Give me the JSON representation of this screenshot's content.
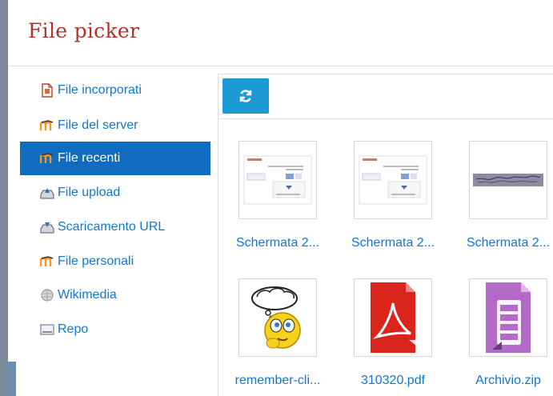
{
  "dialog": {
    "title": "File picker"
  },
  "sidebar": {
    "items": [
      {
        "label": "File incorporati",
        "icon": "embedded-file-icon",
        "active": false
      },
      {
        "label": "File del server",
        "icon": "moodle-icon",
        "active": false
      },
      {
        "label": "File recenti",
        "icon": "moodle-icon",
        "active": true
      },
      {
        "label": "File upload",
        "icon": "upload-icon",
        "active": false
      },
      {
        "label": "Scaricamento URL",
        "icon": "url-download-icon",
        "active": false
      },
      {
        "label": "File personali",
        "icon": "moodle-icon",
        "active": false
      },
      {
        "label": "Wikimedia",
        "icon": "wikimedia-icon",
        "active": false
      },
      {
        "label": "Repo",
        "icon": "repository-icon",
        "active": false
      }
    ]
  },
  "toolbar": {
    "refresh_icon": "refresh-icon"
  },
  "files": [
    {
      "name": "Schermata 2...",
      "thumb": "screenshot-thumbnail"
    },
    {
      "name": "Schermata 2...",
      "thumb": "screenshot-thumbnail"
    },
    {
      "name": "Schermata 2...",
      "thumb": "handwriting-thumbnail"
    },
    {
      "name": "remember-cli...",
      "thumb": "thinking-smiley-icon"
    },
    {
      "name": "310320.pdf",
      "thumb": "pdf-file-icon"
    },
    {
      "name": "Archivio.zip",
      "thumb": "zip-archive-icon"
    }
  ],
  "colors": {
    "accent": "#0f6cbf",
    "link": "#1177d1",
    "title": "#b2302a",
    "button": "#1c9ad6"
  }
}
